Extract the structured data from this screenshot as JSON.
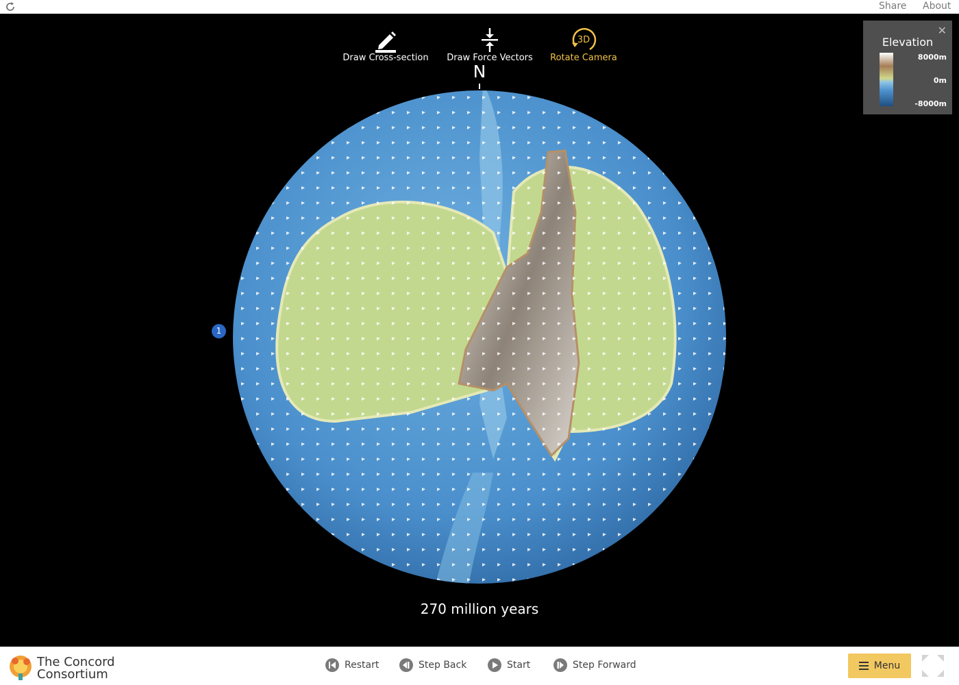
{
  "header": {
    "share_label": "Share",
    "about_label": "About"
  },
  "toolbar": {
    "items": [
      {
        "label": "Draw Cross-section",
        "icon": "pencil-icon",
        "active": false
      },
      {
        "label": "Draw Force Vectors",
        "icon": "force-vectors-icon",
        "active": false
      },
      {
        "label": "Rotate Camera",
        "icon": "rotate-3d-icon",
        "icon_text": "3D",
        "active": true
      }
    ]
  },
  "compass": {
    "north_label": "N"
  },
  "marker": {
    "label": "1"
  },
  "time": {
    "label": "270 million years"
  },
  "legend": {
    "title": "Elevation",
    "max_label": "8000m",
    "mid_label": "0m",
    "min_label": "-8000m",
    "close_icon": "close-icon",
    "colors": {
      "high": "#ffffff",
      "land": "#cfd88a",
      "shallow": "#8fc4e6",
      "deep": "#1f4f80"
    }
  },
  "footer": {
    "logo_line1": "The Concord",
    "logo_line2": "Consortium",
    "restart_label": "Restart",
    "step_back_label": "Step Back",
    "start_label": "Start",
    "step_forward_label": "Step Forward",
    "menu_label": "Menu",
    "accent_color": "#f2c860"
  }
}
